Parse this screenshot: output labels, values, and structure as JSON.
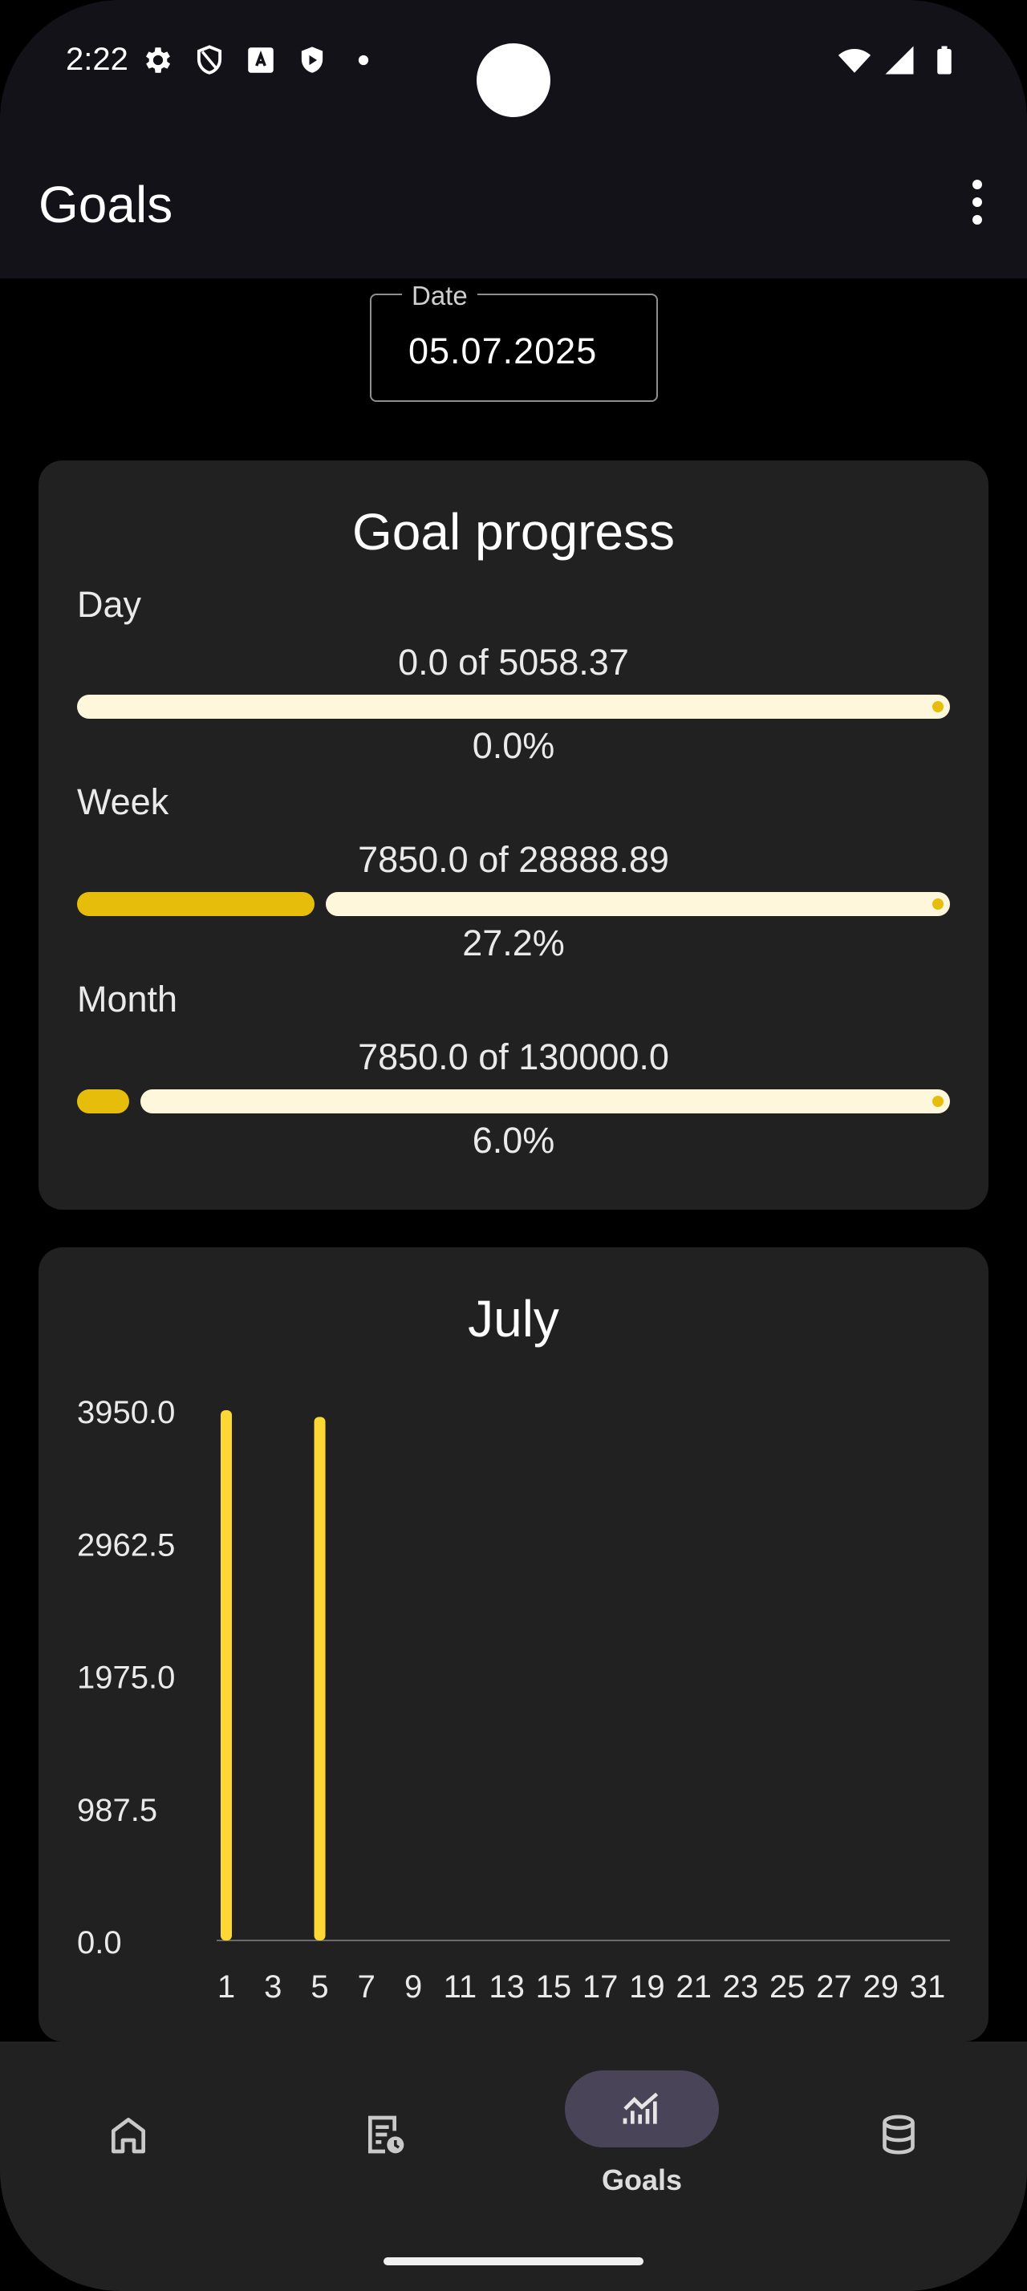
{
  "status_bar": {
    "time": "2:22"
  },
  "app_bar": {
    "title": "Goals"
  },
  "date_field": {
    "label": "Date",
    "value": "05.07.2025"
  },
  "progress_card": {
    "title": "Goal progress",
    "items": [
      {
        "label": "Day",
        "amount": "0.0 of 5058.37",
        "percent_text": "0.0%",
        "fraction": 0.0
      },
      {
        "label": "Week",
        "amount": "7850.0 of 28888.89",
        "percent_text": "27.2%",
        "fraction": 0.272
      },
      {
        "label": "Month",
        "amount": "7850.0 of 130000.0",
        "percent_text": "6.0%",
        "fraction": 0.06
      }
    ],
    "colors": {
      "fill": "#E7BD0B",
      "track": "#FEF7DC"
    }
  },
  "chart_data": {
    "type": "bar",
    "title": "July",
    "x": [
      1,
      2,
      3,
      4,
      5,
      6,
      7,
      8,
      9,
      10,
      11,
      12,
      13,
      14,
      15,
      16,
      17,
      18,
      19,
      20,
      21,
      22,
      23,
      24,
      25,
      26,
      27,
      28,
      29,
      30,
      31
    ],
    "values": [
      3950,
      0,
      0,
      0,
      3900,
      0,
      0,
      0,
      0,
      0,
      0,
      0,
      0,
      0,
      0,
      0,
      0,
      0,
      0,
      0,
      0,
      0,
      0,
      0,
      0,
      0,
      0,
      0,
      0,
      0,
      0
    ],
    "x_tick_labels": [
      "1",
      "3",
      "5",
      "7",
      "9",
      "11",
      "13",
      "15",
      "17",
      "19",
      "21",
      "23",
      "25",
      "27",
      "29",
      "31"
    ],
    "y_tick_labels": [
      "3950.0",
      "2962.5",
      "1975.0",
      "987.5",
      "0.0"
    ],
    "ylim": [
      0,
      3950
    ],
    "bar_color": "#FDD835",
    "grid": false
  },
  "bottom_nav": {
    "items": [
      {
        "icon": "home-icon",
        "label": ""
      },
      {
        "icon": "history-icon",
        "label": ""
      },
      {
        "icon": "goals-chart-icon",
        "label": "Goals"
      },
      {
        "icon": "database-icon",
        "label": ""
      }
    ],
    "active_index": 2
  }
}
